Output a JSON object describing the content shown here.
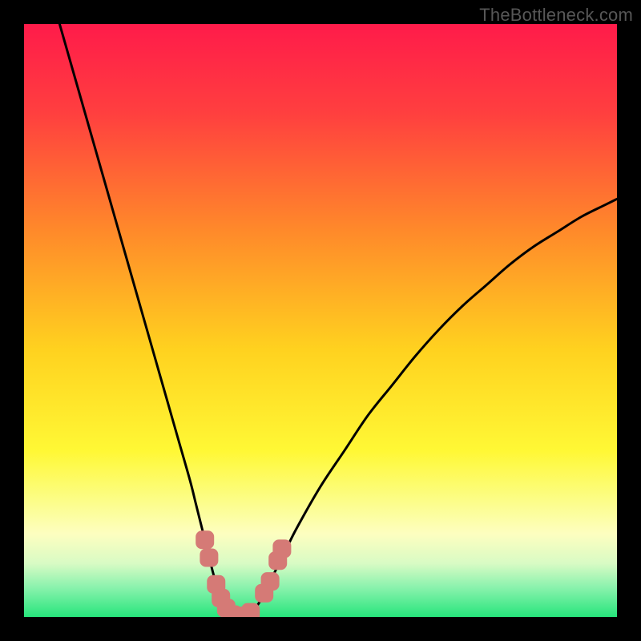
{
  "watermark": "TheBottleneck.com",
  "colors": {
    "frame": "#000000",
    "curve": "#000000",
    "marker_fill": "#d57a76",
    "marker_stroke": "#d57a76",
    "gradient_stops": [
      {
        "offset": 0.0,
        "color": "#ff1b4a"
      },
      {
        "offset": 0.15,
        "color": "#ff3f3f"
      },
      {
        "offset": 0.35,
        "color": "#ff8a2a"
      },
      {
        "offset": 0.55,
        "color": "#ffd21f"
      },
      {
        "offset": 0.72,
        "color": "#fff835"
      },
      {
        "offset": 0.8,
        "color": "#fcfd84"
      },
      {
        "offset": 0.86,
        "color": "#fdfec0"
      },
      {
        "offset": 0.91,
        "color": "#d8fbc4"
      },
      {
        "offset": 0.95,
        "color": "#8af2ad"
      },
      {
        "offset": 1.0,
        "color": "#27e57c"
      }
    ]
  },
  "chart_data": {
    "type": "line",
    "title": "",
    "xlabel": "",
    "ylabel": "",
    "xlim": [
      0,
      100
    ],
    "ylim": [
      0,
      100
    ],
    "grid": false,
    "legend": false,
    "series": [
      {
        "name": "bottleneck-curve",
        "x": [
          6,
          8,
          10,
          12,
          14,
          16,
          18,
          20,
          22,
          24,
          26,
          28,
          29,
          30,
          31,
          32,
          33,
          34,
          35,
          36,
          37,
          38,
          39,
          40,
          42,
          44,
          46,
          50,
          54,
          58,
          62,
          66,
          70,
          74,
          78,
          82,
          86,
          90,
          94,
          98,
          100
        ],
        "y": [
          100,
          93,
          86,
          79,
          72,
          65,
          58,
          51,
          44,
          37,
          30,
          23,
          19,
          15,
          11,
          7,
          4,
          2,
          0.5,
          0,
          0,
          0.5,
          1.5,
          3,
          7,
          11,
          15,
          22,
          28,
          34,
          39,
          44,
          48.5,
          52.5,
          56,
          59.5,
          62.5,
          65,
          67.5,
          69.5,
          70.5
        ]
      }
    ],
    "markers": [
      {
        "x": 30.5,
        "y": 13
      },
      {
        "x": 31.2,
        "y": 10
      },
      {
        "x": 32.4,
        "y": 5.5
      },
      {
        "x": 33.2,
        "y": 3.2
      },
      {
        "x": 34.1,
        "y": 1.5
      },
      {
        "x": 35.2,
        "y": 0.4
      },
      {
        "x": 36.2,
        "y": 0.0
      },
      {
        "x": 37.2,
        "y": 0.2
      },
      {
        "x": 38.2,
        "y": 0.8
      },
      {
        "x": 40.5,
        "y": 4.0
      },
      {
        "x": 41.5,
        "y": 6.0
      },
      {
        "x": 42.8,
        "y": 9.5
      },
      {
        "x": 43.5,
        "y": 11.5
      }
    ]
  }
}
